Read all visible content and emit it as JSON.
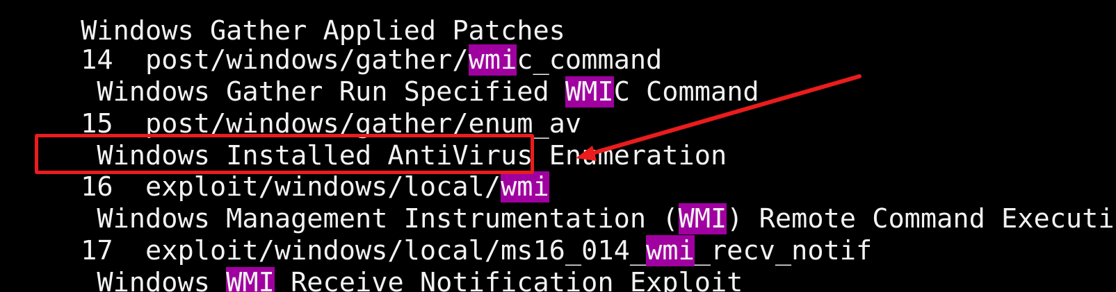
{
  "terminal": {
    "background": "#000000",
    "text_color": "#f2f2f2",
    "highlight_color": "#a000a0",
    "annotation_color": "#ea1c1c",
    "lines": [
      {
        "segments": [
          {
            "text": " Windows Gather Applied Patches",
            "hl": false
          }
        ]
      },
      {
        "segments": [
          {
            "text": " 14  post/windows/gather/",
            "hl": false
          },
          {
            "text": "wmi",
            "hl": true
          },
          {
            "text": "c_command",
            "hl": false
          }
        ]
      },
      {
        "segments": [
          {
            "text": "  Windows Gather Run Specified ",
            "hl": false
          },
          {
            "text": "WMI",
            "hl": true
          },
          {
            "text": "C Command",
            "hl": false
          }
        ]
      },
      {
        "segments": [
          {
            "text": " 15  post/windows/gather/enum_av",
            "hl": false
          }
        ]
      },
      {
        "segments": [
          {
            "text": "  Windows Installed AntiVirus Enumeration",
            "hl": false
          }
        ]
      },
      {
        "segments": [
          {
            "text": " 16  exploit/windows/local/",
            "hl": false
          },
          {
            "text": "wmi",
            "hl": true
          }
        ]
      },
      {
        "segments": [
          {
            "text": "  Windows Management Instrumentation (",
            "hl": false
          },
          {
            "text": "WMI",
            "hl": true
          },
          {
            "text": ") Remote Command Executio",
            "hl": false
          }
        ]
      },
      {
        "segments": [
          {
            "text": " 17  exploit/windows/local/ms16_014_",
            "hl": false
          },
          {
            "text": "wmi",
            "hl": true
          },
          {
            "text": "_recv_notif",
            "hl": false
          }
        ]
      },
      {
        "segments": [
          {
            "text": "  Windows ",
            "hl": false
          },
          {
            "text": "WMI",
            "hl": true
          },
          {
            "text": " Receive Notification Exploit",
            "hl": false
          }
        ]
      }
    ]
  }
}
